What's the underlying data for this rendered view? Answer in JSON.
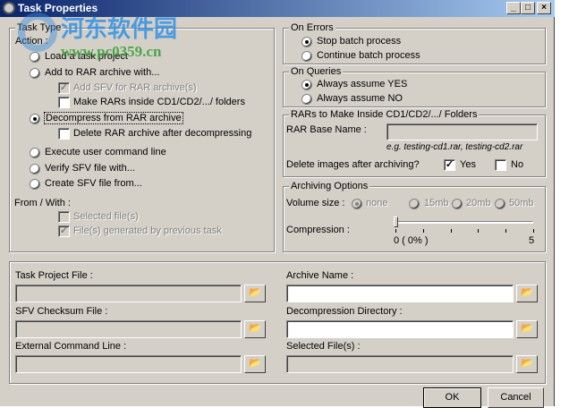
{
  "window": {
    "title": "Task Properties",
    "minimize": "_",
    "maximize": "□",
    "close": "×"
  },
  "watermark": {
    "name": "河东软件园",
    "url": "www.pc0359.cn"
  },
  "task_type": {
    "legend": "Task Type",
    "action_label": "Action :",
    "options": [
      {
        "label": "Load a task project",
        "selected": false
      },
      {
        "label": "Add to RAR archive with...",
        "selected": false
      },
      {
        "label": "Decompress from RAR archive",
        "selected": true
      },
      {
        "label": "Execute user command line",
        "selected": false
      },
      {
        "label": "Verify SFV file with...",
        "selected": false
      },
      {
        "label": "Create SFV file from...",
        "selected": false
      }
    ],
    "add_sfv": {
      "label": "Add SFV for RAR archive(s)",
      "checked": true,
      "disabled": true
    },
    "make_rars_cd": {
      "label": "Make RARs inside CD1/CD2/.../ folders",
      "checked": false
    },
    "delete_after": {
      "label": "Delete RAR archive after decompressing",
      "checked": false
    },
    "from_with_label": "From / With :",
    "selected_files": {
      "label": "Selected file(s)",
      "checked": false
    },
    "generated_files": {
      "label": "File(s) generated by previous task",
      "checked": true
    }
  },
  "on_errors": {
    "legend": "On Errors",
    "options": [
      {
        "label": "Stop batch process",
        "selected": true
      },
      {
        "label": "Continue batch process",
        "selected": false
      }
    ]
  },
  "on_queries": {
    "legend": "On Queries",
    "options": [
      {
        "label": "Always assume YES",
        "selected": true
      },
      {
        "label": "Always assume NO",
        "selected": false
      }
    ]
  },
  "rars_cd": {
    "legend": "RARs to Make Inside CD1/CD2/.../ Folders",
    "base_name_label": "RAR Base Name :",
    "base_name_value": "",
    "example": "e.g. testing-cd1.rar, testing-cd2.rar",
    "delete_images_label": "Delete images after archiving?",
    "yes_label": "Yes",
    "yes_checked": true,
    "no_label": "No",
    "no_checked": false
  },
  "archiving": {
    "legend": "Archiving Options",
    "volume_label": "Volume size :",
    "volumes": [
      {
        "label": "none",
        "selected": true
      },
      {
        "label": "15mb",
        "selected": false
      },
      {
        "label": "20mb",
        "selected": false
      },
      {
        "label": "50mb",
        "selected": false
      }
    ],
    "compression_label": "Compression :",
    "compression_value": 0,
    "compression_max": 5,
    "compression_min_label": "0 ( 0% )",
    "compression_max_label": "5"
  },
  "files": {
    "task_project_label": "Task Project File :",
    "task_project_value": "",
    "sfv_label": "SFV Checksum File :",
    "sfv_value": "",
    "external_label": "External Command Line :",
    "external_value": "",
    "archive_name_label": "Archive Name :",
    "archive_name_value": "",
    "decompression_dir_label": "Decompression Directory :",
    "decompression_dir_value": "",
    "selected_files_label": "Selected File(s) :",
    "selected_files_value": ""
  },
  "buttons": {
    "ok": "OK",
    "cancel": "Cancel"
  }
}
